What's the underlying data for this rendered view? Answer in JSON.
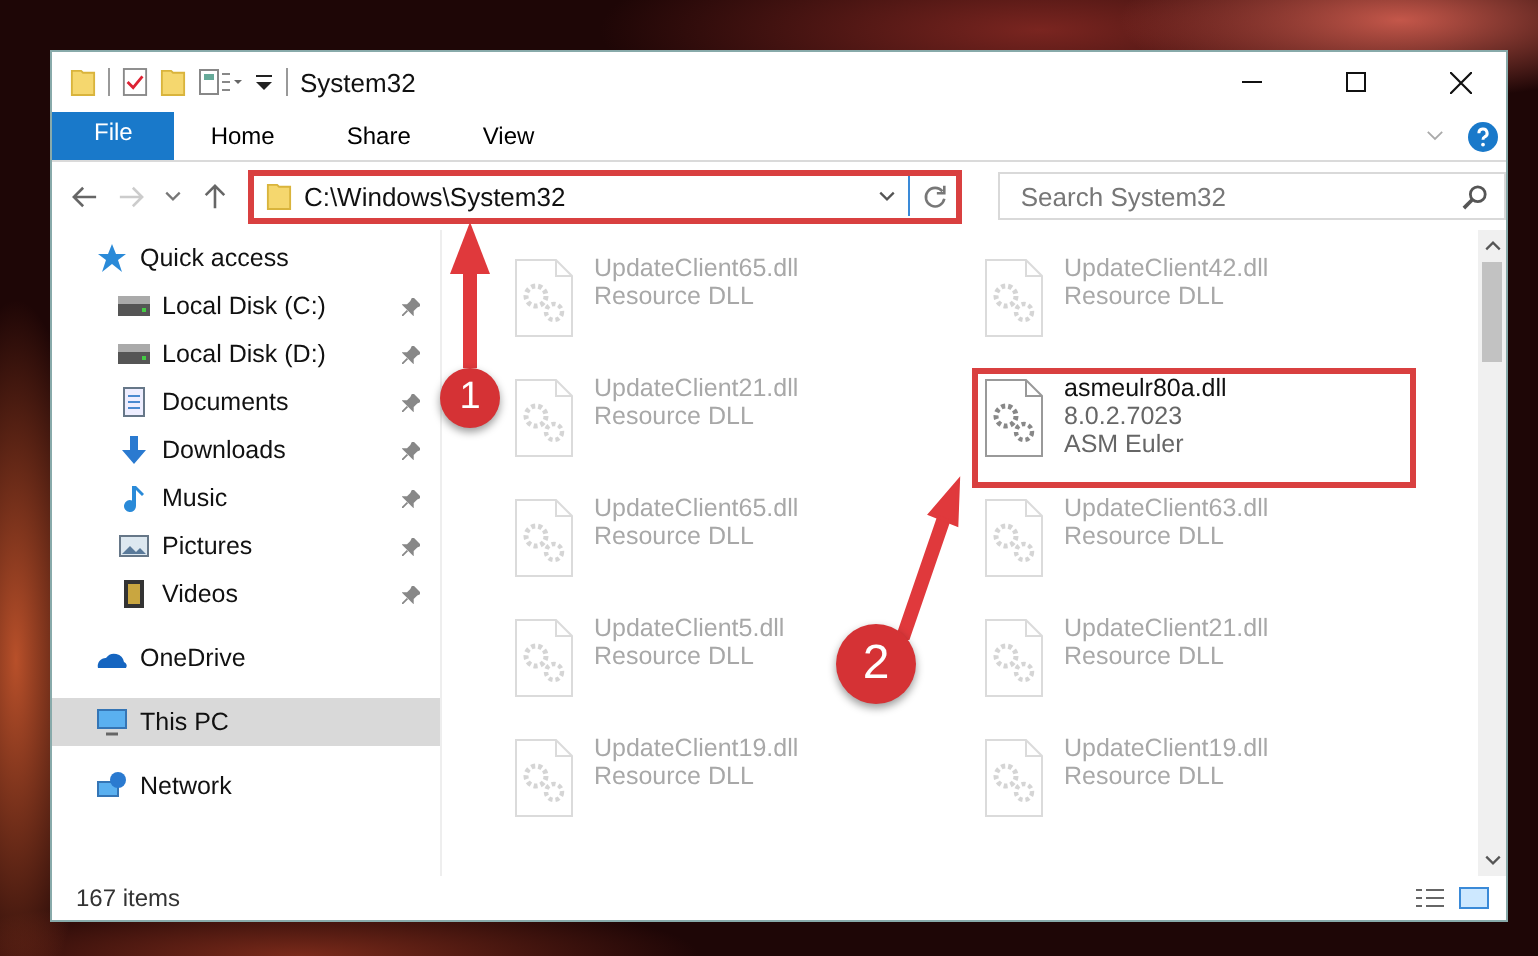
{
  "window": {
    "title": "System32"
  },
  "ribbon": {
    "tabs": [
      {
        "label": "File",
        "kind": "file",
        "selected": false
      },
      {
        "label": "Home",
        "kind": "tab",
        "selected": false
      },
      {
        "label": "Share",
        "kind": "tab",
        "selected": false
      },
      {
        "label": "View",
        "kind": "tab",
        "selected": false
      }
    ]
  },
  "address_bar": {
    "path": "C:\\Windows\\System32",
    "highlighted": true
  },
  "search": {
    "placeholder": "Search System32"
  },
  "sidebar": {
    "items": [
      {
        "label": "Quick access",
        "kind": "star",
        "selected": false,
        "children": [
          {
            "label": "Local Disk (C:)",
            "kind": "drive",
            "pinned": true,
            "selected": false
          },
          {
            "label": "Local Disk (D:)",
            "kind": "drive",
            "pinned": true,
            "selected": false
          },
          {
            "label": "Documents",
            "kind": "documents",
            "pinned": true,
            "selected": false
          },
          {
            "label": "Downloads",
            "kind": "downloads",
            "pinned": true,
            "selected": false
          },
          {
            "label": "Music",
            "kind": "music",
            "pinned": true,
            "selected": false
          },
          {
            "label": "Pictures",
            "kind": "pictures",
            "pinned": true,
            "selected": false
          },
          {
            "label": "Videos",
            "kind": "videos",
            "pinned": true,
            "selected": false
          }
        ]
      },
      {
        "label": "OneDrive",
        "kind": "cloud",
        "selected": false
      },
      {
        "label": "This PC",
        "kind": "computer",
        "selected": true
      },
      {
        "label": "Network",
        "kind": "network",
        "selected": false
      }
    ]
  },
  "files": [
    {
      "name": "UpdateClient65.dll",
      "lines": [
        "Resource DLL"
      ],
      "blurred": true,
      "highlighted": false
    },
    {
      "name": "UpdateClient42.dll",
      "lines": [
        "Resource DLL"
      ],
      "blurred": true,
      "highlighted": false
    },
    {
      "name": "UpdateClient21.dll",
      "lines": [
        "Resource DLL"
      ],
      "blurred": true,
      "highlighted": false
    },
    {
      "name": "asmeulr80a.dll",
      "lines": [
        "8.0.2.7023",
        "ASM Euler"
      ],
      "blurred": false,
      "highlighted": true
    },
    {
      "name": "UpdateClient65.dll",
      "lines": [
        "Resource DLL"
      ],
      "blurred": true,
      "highlighted": false
    },
    {
      "name": "UpdateClient63.dll",
      "lines": [
        "Resource DLL"
      ],
      "blurred": true,
      "highlighted": false
    },
    {
      "name": "UpdateClient5.dll",
      "lines": [
        "Resource DLL"
      ],
      "blurred": true,
      "highlighted": false
    },
    {
      "name": "UpdateClient21.dll",
      "lines": [
        "Resource DLL"
      ],
      "blurred": true,
      "highlighted": false
    },
    {
      "name": "UpdateClient19.dll",
      "lines": [
        "Resource DLL"
      ],
      "blurred": true,
      "highlighted": false
    },
    {
      "name": "UpdateClient19.dll",
      "lines": [
        "Resource DLL"
      ],
      "blurred": true,
      "highlighted": false
    }
  ],
  "status_bar": {
    "count": "167 items"
  },
  "annotations": [
    {
      "number": "1"
    },
    {
      "number": "2"
    }
  ]
}
